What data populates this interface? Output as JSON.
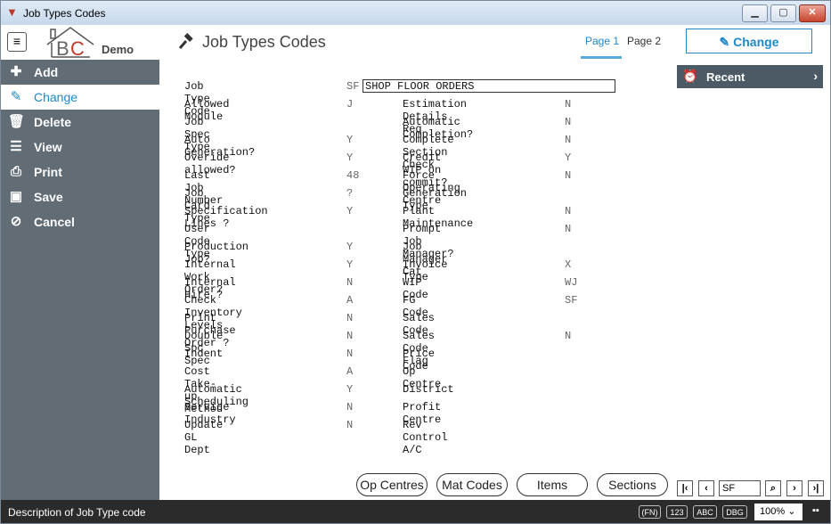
{
  "window": {
    "title": "Job Types Codes"
  },
  "header": {
    "logo_text": "BC",
    "logo_sub": "Demo",
    "page_title": "Job Types Codes",
    "tabs": [
      "Page 1",
      "Page 2"
    ],
    "action_button": "Change"
  },
  "sidebar": {
    "items": [
      {
        "label": "Add",
        "icon": "plus-icon"
      },
      {
        "label": "Change",
        "icon": "pencil-icon"
      },
      {
        "label": "Delete",
        "icon": "trash-icon"
      },
      {
        "label": "View",
        "icon": "list-icon"
      },
      {
        "label": "Print",
        "icon": "printer-icon"
      },
      {
        "label": "Save",
        "icon": "floppy-icon"
      },
      {
        "label": "Cancel",
        "icon": "ban-icon"
      }
    ]
  },
  "recent": {
    "label": "Recent"
  },
  "form": {
    "job_type_code": {
      "label": "Job Type Code",
      "code": "SF",
      "description": "SHOP FLOOR ORDERS"
    },
    "left": [
      {
        "label": "Allowed Module",
        "value": "J"
      },
      {
        "label": "Job Spec Type",
        "value": ""
      },
      {
        "label": "Auto Generation?",
        "value": "Y"
      },
      {
        "label": "Overide allowed?",
        "value": "Y"
      },
      {
        "label": "Last Job Number",
        "value": "48"
      },
      {
        "label": "Job Card Type",
        "value": "?"
      },
      {
        "label": "Specification Lines ?",
        "value": "Y"
      },
      {
        "label": "User Code Type",
        "value": ""
      },
      {
        "label": "Production Job?",
        "value": "Y"
      },
      {
        "label": "Internal Work Order?",
        "value": "Y"
      },
      {
        "label": "Internal Hire ?",
        "value": "N"
      },
      {
        "label": "Check Inventory Levels",
        "value": "A"
      },
      {
        "label": "Print Purchase Order ?",
        "value": "N"
      },
      {
        "label": "Double Spc Spec",
        "value": "N"
      },
      {
        "label": "Indent",
        "value": "N"
      },
      {
        "label": "Cost Take-up Method",
        "value": "A"
      },
      {
        "label": "Automatic Scheduling",
        "value": "Y"
      },
      {
        "label": "Service Industry",
        "value": "N"
      },
      {
        "label": "Update GL Dept",
        "value": "N"
      }
    ],
    "right": [
      {
        "label": "Estimation Details Req",
        "value": "N"
      },
      {
        "label": "Automatic Completion?",
        "value": "N"
      },
      {
        "label": "Complete Section Check",
        "value": "N"
      },
      {
        "label": "Credit WIP on commit?",
        "value": "Y"
      },
      {
        "label": "Force Operating Centre",
        "value": "N"
      },
      {
        "label": "Generation Type",
        "value": ""
      },
      {
        "label": "Plant Maintenance",
        "value": "N"
      },
      {
        "label": "Prompt Job Manager?",
        "value": "N"
      },
      {
        "label": "Job Manager Cat",
        "value": ""
      },
      {
        "label": "Invoice Type",
        "value": "X"
      },
      {
        "label": "WIP Code",
        "value": "WJ"
      },
      {
        "label": "FG Code",
        "value": "SF"
      },
      {
        "label": "Sales Code",
        "value": ""
      },
      {
        "label": "Sales Code Flag",
        "value": "N"
      },
      {
        "label": "Price Code",
        "value": ""
      },
      {
        "label": "Op Centre",
        "value": ""
      },
      {
        "label": "District",
        "value": ""
      },
      {
        "label": "Profit Centre",
        "value": ""
      },
      {
        "label": "Rev Control A/C",
        "value": ""
      }
    ]
  },
  "bottom_buttons": [
    "Op Centres",
    "Mat Codes",
    "Items",
    "Sections"
  ],
  "navigator": {
    "value": "SF"
  },
  "statusbar": {
    "description": "Description of Job Type code",
    "indicators": [
      "(FN)",
      "123",
      "ABC",
      "DBG"
    ],
    "zoom": "100%"
  },
  "colors": {
    "accent": "#1e88c8",
    "sidebar": "#616c75",
    "statusbar": "#2b2b2b"
  }
}
